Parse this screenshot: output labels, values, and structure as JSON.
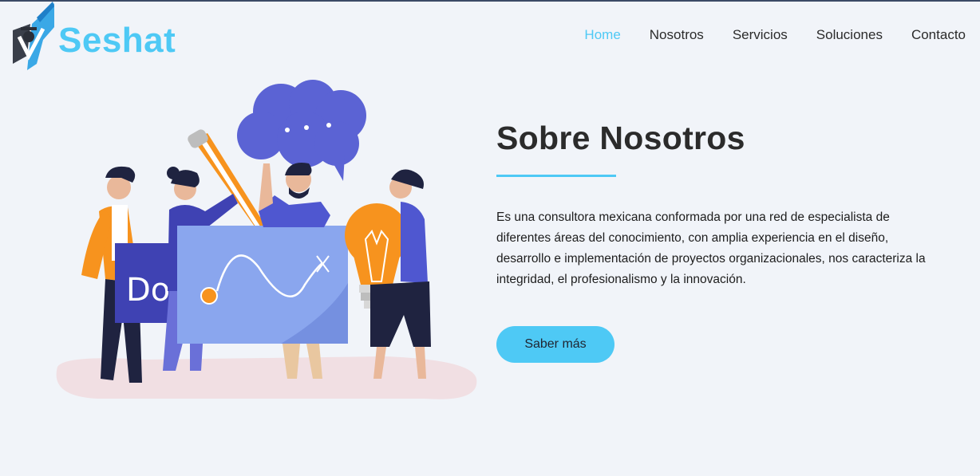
{
  "brand": {
    "name": "Seshat"
  },
  "nav": {
    "items": [
      {
        "label": "Home",
        "active": true
      },
      {
        "label": "Nosotros",
        "active": false
      },
      {
        "label": "Servicios",
        "active": false
      },
      {
        "label": "Soluciones",
        "active": false
      },
      {
        "label": "Contacto",
        "active": false
      }
    ]
  },
  "hero": {
    "title": "Sobre Nosotros",
    "description": "Es una consultora mexicana conformada por una red de especialista de diferentes áreas del conocimiento, con amplia experiencia en el diseño, desarrollo e implementación de proyectos organizacionales, nos caracteriza la integridad, el profesionalismo y la innovación.",
    "button_label": "Saber más",
    "board_text": "Do!"
  },
  "colors": {
    "accent": "#4ec9f5",
    "background": "#f1f4f9",
    "text": "#2b2b2b",
    "purple": "#5b63d4",
    "orange": "#f7931e"
  },
  "icons": {
    "logo": "seshat-logo-icon",
    "illustration": "team-collaboration-illustration"
  }
}
